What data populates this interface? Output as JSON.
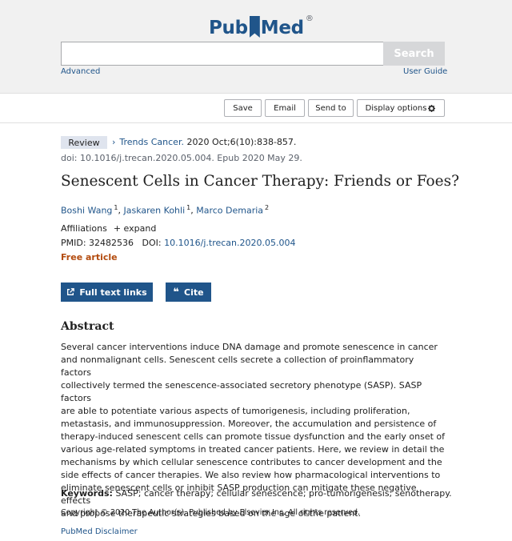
{
  "header": {
    "logo_pub": "Pub",
    "logo_med": "Med",
    "logo_reg": "®",
    "search_value": "",
    "search_button": "Search",
    "advanced": "Advanced",
    "user_guide": "User Guide"
  },
  "toolbar": {
    "save": "Save",
    "email": "Email",
    "send_to": "Send to",
    "display_options": "Display options"
  },
  "article": {
    "badge": "Review",
    "journal": "Trends Cancer.",
    "citation": "2020 Oct;6(10):838-857.",
    "doi_line": "doi: 10.1016/j.trecan.2020.05.004. Epub 2020 May 29.",
    "title": "Senescent Cells in Cancer Therapy: Friends or Foes?",
    "authors": [
      {
        "name": "Boshi Wang",
        "sup": "1"
      },
      {
        "name": "Jaskaren Kohli",
        "sup": "1"
      },
      {
        "name": "Marco Demaria",
        "sup": "2"
      }
    ],
    "affiliations": "Affiliations",
    "expand": "+ expand",
    "pmid_label": "PMID:",
    "pmid": "32482536",
    "doi_label": "DOI:",
    "doi": "10.1016/j.trecan.2020.05.004",
    "free": "Free article"
  },
  "actions": {
    "full_text": "Full text links",
    "cite": "Cite"
  },
  "abstract": {
    "heading": "Abstract",
    "lines": [
      "Several cancer interventions induce DNA damage and promote senescence in cancer",
      "and nonmalignant cells. Senescent cells secrete a collection of proinflammatory factors",
      "collectively termed the senescence-associated secretory phenotype (SASP). SASP factors",
      "are able to potentiate various aspects of tumorigenesis, including proliferation,",
      "metastasis, and immunosuppression. Moreover, the accumulation and persistence of",
      "therapy-induced senescent cells can promote tissue dysfunction and the early onset of",
      "various age-related symptoms in treated cancer patients. Here, we review in detail the",
      "mechanisms by which cellular senescence contributes to cancer development and the",
      "side effects of cancer therapies. We also review how pharmacological interventions to",
      "eliminate senescent cells or inhibit SASP production can mitigate these negative effects",
      "and propose therapeutic strategies based on the age of the patient."
    ],
    "keywords_label": "Keywords:",
    "keywords": "SASP; cancer therapy; cellular senescence; pro-tumorigenesis; senotherapy.",
    "copyright": "Copyright © 2020 The Author(s). Published by Elsevier Inc. All rights reserved.",
    "disclaimer": "PubMed Disclaimer"
  },
  "icons": {
    "gear": "gear-icon",
    "external_link": "external-link-icon",
    "quote": "quote-icon",
    "chevron": "chevron-right-icon"
  },
  "colors": {
    "brand": "#20558a",
    "free_article": "#b34b0e",
    "header_bg": "#f1f1f1"
  }
}
